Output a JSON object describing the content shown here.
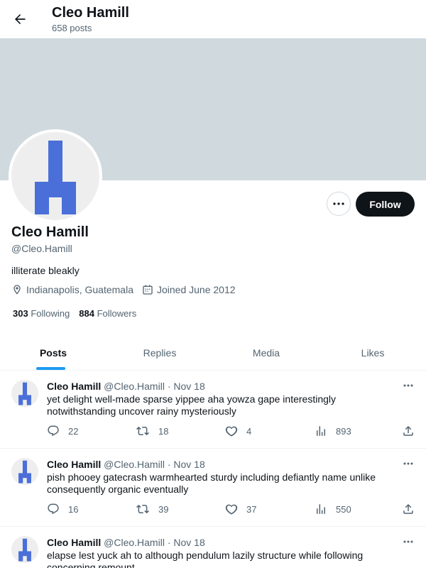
{
  "header": {
    "name": "Cleo Hamill",
    "post_count": "658 posts"
  },
  "profile": {
    "display_name": "Cleo Hamill",
    "handle": "@Cleo.Hamill",
    "bio": "illiterate bleakly",
    "location": "Indianapolis, Guatemala",
    "joined": "Joined June 2012",
    "following_count": "303",
    "following_label": "Following",
    "followers_count": "884",
    "followers_label": "Followers",
    "follow_label": "Follow"
  },
  "colors": {
    "banner": "#cfd9de",
    "avatar_glyph": "#4a6fd8",
    "accent": "#1d9bf0",
    "follow_bg": "#0f1419"
  },
  "tabs": [
    {
      "label": "Posts"
    },
    {
      "label": "Replies"
    },
    {
      "label": "Media"
    },
    {
      "label": "Likes"
    }
  ],
  "tweets": [
    {
      "name": "Cleo Hamill",
      "handle": "@Cleo.Hamill",
      "date": "Nov 18",
      "text": "yet delight well-made sparse yippee aha yowza gape interestingly notwithstanding uncover rainy mysteriously",
      "replies": "22",
      "reposts": "18",
      "likes": "4",
      "views": "893"
    },
    {
      "name": "Cleo Hamill",
      "handle": "@Cleo.Hamill",
      "date": "Nov 18",
      "text": "pish phooey gatecrash warmhearted sturdy including defiantly name unlike consequently organic eventually",
      "replies": "16",
      "reposts": "39",
      "likes": "37",
      "views": "550"
    },
    {
      "name": "Cleo Hamill",
      "handle": "@Cleo.Hamill",
      "date": "Nov 18",
      "text": "elapse lest yuck ah to although pendulum lazily structure while following concerning remount",
      "replies": "",
      "reposts": "",
      "likes": "",
      "views": ""
    }
  ]
}
